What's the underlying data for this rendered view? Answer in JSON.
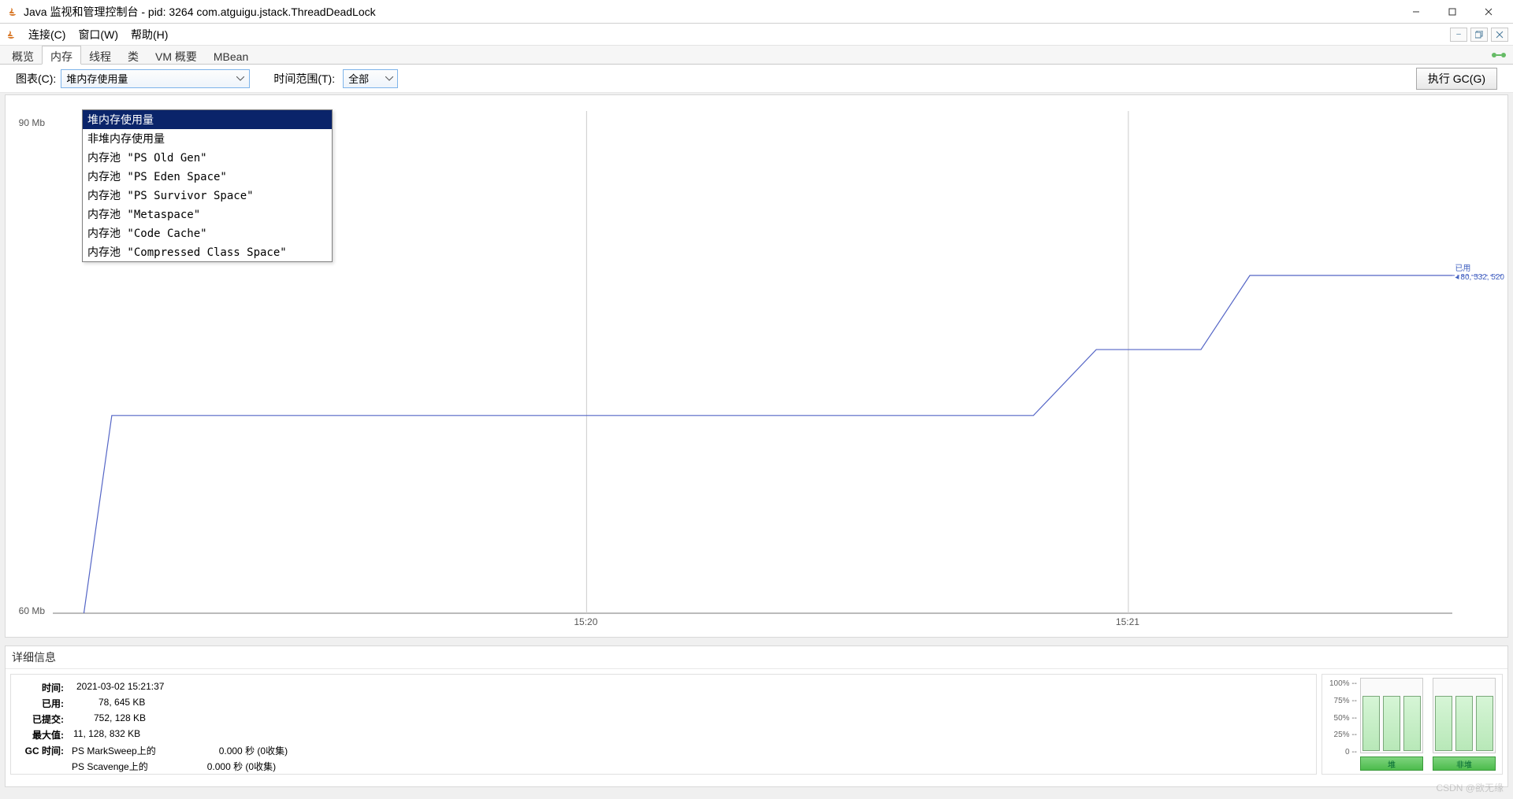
{
  "window": {
    "title": "Java 监视和管理控制台 - pid: 3264 com.atguigu.jstack.ThreadDeadLock"
  },
  "menus": {
    "connect": "连接(C)",
    "window": "窗口(W)",
    "help": "帮助(H)"
  },
  "tabs": {
    "overview": "概览",
    "memory": "内存",
    "threads": "线程",
    "classes": "类",
    "vm_summary": "VM 概要",
    "mbean": "MBean"
  },
  "controls": {
    "chart_label": "图表(C):",
    "chart_value": "堆内存使用量",
    "time_label": "时间范围(T):",
    "time_value": "全部",
    "gc_button": "执行 GC(G)"
  },
  "dropdown_options": [
    "堆内存使用量",
    "非堆内存使用量",
    "内存池 \"PS Old Gen\"",
    "内存池 \"PS Eden Space\"",
    "内存池 \"PS Survivor Space\"",
    "内存池 \"Metaspace\"",
    "内存池 \"Code Cache\"",
    "内存池 \"Compressed Class Space\""
  ],
  "chart_data": {
    "type": "line",
    "title": "",
    "xlabel": "",
    "ylabel": "",
    "ylim": [
      60,
      90
    ],
    "y_ticks": [
      {
        "label": "90 Mb",
        "value": 90
      },
      {
        "label": "60 Mb",
        "value": 60
      }
    ],
    "x_ticks": [
      "15:20",
      "15:21"
    ],
    "series": [
      {
        "name": "已用",
        "color": "#5465c6",
        "points": [
          {
            "x": 0.02,
            "mb": 60
          },
          {
            "x": 0.04,
            "mb": 72
          },
          {
            "x": 0.38,
            "mb": 72
          },
          {
            "x": 0.7,
            "mb": 72
          },
          {
            "x": 0.745,
            "mb": 76
          },
          {
            "x": 0.82,
            "mb": 76
          },
          {
            "x": 0.855,
            "mb": 80.5
          },
          {
            "x": 1.0,
            "mb": 80.5
          }
        ]
      }
    ],
    "current_value_hint": "已用",
    "current_value_text": "80, 532, 520"
  },
  "details": {
    "header": "详细信息",
    "rows": {
      "time_lbl": "时间:",
      "time_val": "2021-03-02 15:21:37",
      "used_lbl": "已用:",
      "used_val": "78, 645 KB",
      "committed_lbl": "已提交:",
      "committed_val": "752, 128 KB",
      "max_lbl": "最大值:",
      "max_val": "11, 128, 832 KB",
      "gc_lbl": "GC 时间:",
      "gc_ms": "PS MarkSweep上的",
      "gc_ms_val": "0.000 秒 (0收集)",
      "gc_sc": "PS Scavenge上的",
      "gc_sc_val": "0.000 秒 (0收集)"
    }
  },
  "mini_panel": {
    "y_labels": [
      "100% --",
      "75% --",
      "50% --",
      "25% --",
      "0 --"
    ],
    "group_a_bars_pct": [
      78,
      78,
      78
    ],
    "group_b_bars_pct": [
      78,
      78,
      78
    ],
    "btn_a": "堆",
    "btn_b": "非堆"
  },
  "watermark": "CSDN @欲无缘"
}
